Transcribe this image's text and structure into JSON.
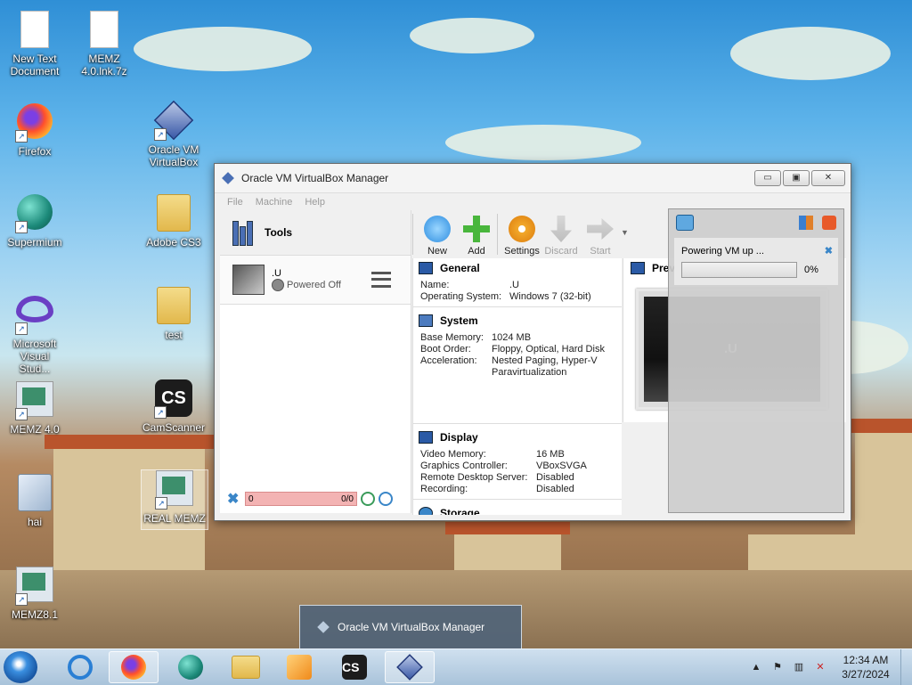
{
  "desktop": {
    "icons": [
      {
        "name": "new-text-document",
        "label": "New Text Document"
      },
      {
        "name": "memz-7z",
        "label": "MEMZ 4.0.lnk.7z"
      },
      {
        "name": "firefox",
        "label": "Firefox"
      },
      {
        "name": "oracle-vm-virtualbox",
        "label": "Oracle VM VirtualBox"
      },
      {
        "name": "supermium",
        "label": "Supermium"
      },
      {
        "name": "adobe-cs3",
        "label": "Adobe CS3"
      },
      {
        "name": "visual-studio",
        "label": "Microsoft Visual Stud..."
      },
      {
        "name": "test",
        "label": "test"
      },
      {
        "name": "memz-40",
        "label": "MEMZ 4.0"
      },
      {
        "name": "camscanner",
        "label": "CamScanner"
      },
      {
        "name": "hai",
        "label": "hai"
      },
      {
        "name": "real-memz",
        "label": "REAL MEMZ"
      },
      {
        "name": "memz81",
        "label": "MEMZ8.1"
      }
    ],
    "camscanner_glyph": "CS"
  },
  "window": {
    "title": "Oracle VM VirtualBox Manager",
    "min_glyph": "▭",
    "max_glyph": "▣",
    "close_glyph": "✕",
    "menu": [
      "File",
      "Machine",
      "Help"
    ],
    "tools_label": "Tools",
    "vm": {
      "name": ".U",
      "state": "Powered Off"
    },
    "left_progress": {
      "value": "0",
      "count": "0/0"
    },
    "toolbar": [
      {
        "label": "New",
        "enabled": true
      },
      {
        "label": "Add",
        "enabled": true
      },
      {
        "label": "Settings",
        "enabled": true
      },
      {
        "label": "Discard",
        "enabled": false
      },
      {
        "label": "Start",
        "enabled": false
      }
    ],
    "general": {
      "title": "General",
      "rows": [
        {
          "k": "Name:",
          "v": ".U"
        },
        {
          "k": "Operating System:",
          "v": "Windows 7 (32-bit)"
        }
      ]
    },
    "system": {
      "title": "System",
      "rows": [
        {
          "k": "Base Memory:",
          "v": "1024 MB"
        },
        {
          "k": "Boot Order:",
          "v": "Floppy, Optical, Hard Disk"
        },
        {
          "k": "Acceleration:",
          "v": "Nested Paging, Hyper-V"
        },
        {
          "k": "",
          "v": "Paravirtualization"
        }
      ]
    },
    "display": {
      "title": "Display",
      "rows": [
        {
          "k": "Video Memory:",
          "v": "16 MB"
        },
        {
          "k": "Graphics Controller:",
          "v": "VBoxSVGA"
        },
        {
          "k": "Remote Desktop Server:",
          "v": "Disabled"
        },
        {
          "k": "Recording:",
          "v": "Disabled"
        }
      ]
    },
    "storage": {
      "title": "Storage"
    },
    "preview": {
      "title": "Previ",
      "vm_label": ".U"
    }
  },
  "notification": {
    "text": "Powering VM up ...",
    "percent": "0%",
    "progress_fraction": 0
  },
  "taskbar": {
    "thumbnail_title": "Oracle VM VirtualBox Manager",
    "time": "12:34 AM",
    "date": "3/27/2024",
    "tray_up": "▲"
  }
}
